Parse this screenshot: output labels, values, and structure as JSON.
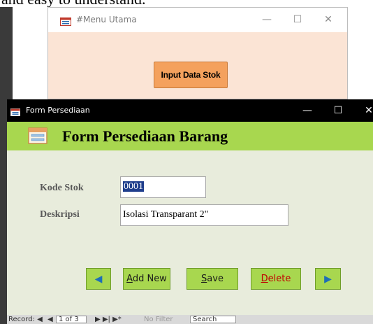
{
  "document": {
    "fragment_text": "and easy to understand."
  },
  "menu_window": {
    "title": "#Menu Utama",
    "controls": {
      "minimize": "—",
      "maximize": "☐",
      "close": "✕"
    },
    "input_button_label": "Input Data Stok",
    "background_color": "#fbe4d5",
    "button_color": "#f4a15d"
  },
  "form_window": {
    "title": "Form Persediaan",
    "controls": {
      "minimize": "—",
      "maximize": "☐",
      "close": "✕"
    },
    "header_title": "Form Persediaan Barang",
    "header_color": "#a8d74f",
    "body_color": "#e8ecdc",
    "fields": {
      "kode_stok": {
        "label": "Kode Stok",
        "value": "0001"
      },
      "deskripsi": {
        "label": "Deskripsi",
        "value": "Isolasi Transparant 2\""
      }
    },
    "buttons": {
      "prev_icon": "◀",
      "add_new": "Add New",
      "save": "Save",
      "delete": "Delete",
      "next_icon": "▶"
    },
    "status_bar": {
      "record_label": "Record: ◀",
      "first_nav": "◀",
      "record_position": "1 of 3",
      "nav_next": "▶ ▶| ▶*",
      "filter_label": "No Filter",
      "search_label": "Search"
    }
  }
}
